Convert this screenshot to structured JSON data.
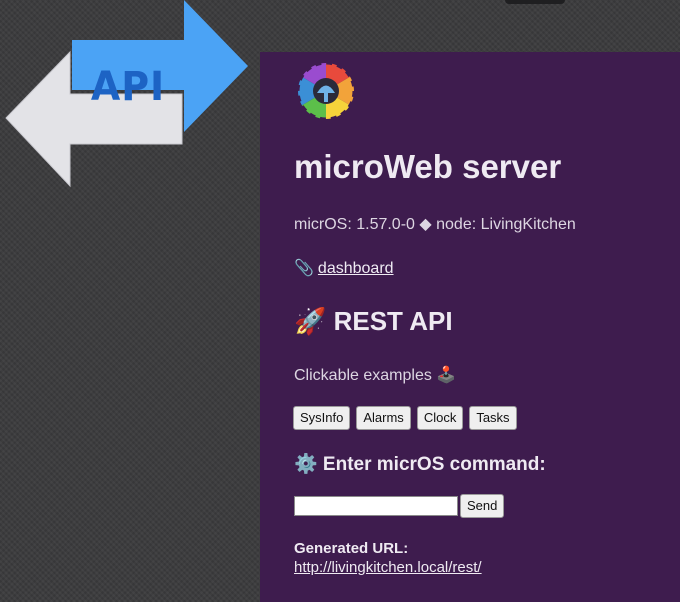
{
  "graphic": {
    "label": "API"
  },
  "panel": {
    "title": "microWeb server",
    "version_line": "micrOS: 1.57.0-0 ◆ node: LivingKitchen",
    "dashboard": {
      "icon": "paperclip-icon",
      "icon_glyph": "📎",
      "label": "dashboard"
    },
    "rest": {
      "icon": "rocket-icon",
      "title": "🚀 REST API"
    },
    "examples": {
      "text": "Clickable examples 🕹️",
      "buttons": [
        "SysInfo",
        "Alarms",
        "Clock",
        "Tasks"
      ]
    },
    "command": {
      "icon": "gear-icon",
      "title": "⚙️ Enter micrOS command:",
      "input_value": "",
      "send_label": "Send"
    },
    "generated": {
      "label": "Generated URL:",
      "url": "http://livingkitchen.local/rest/"
    }
  },
  "colors": {
    "background": "#3b3b3d",
    "panel": "#3e1c4e",
    "arrow_blue": "#4ba3f5",
    "arrow_white": "#e3e3e7",
    "api_text": "#1d63c4"
  }
}
